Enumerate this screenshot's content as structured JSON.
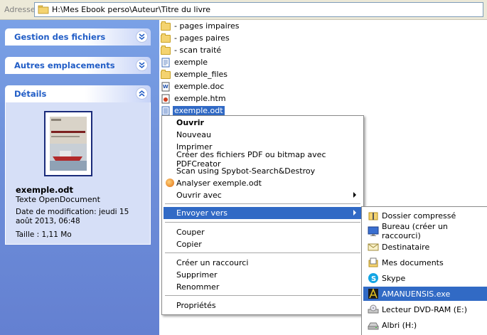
{
  "address_bar": {
    "label": "Adresse",
    "path": "H:\\Mes Ebook perso\\Auteur\\Titre du livre"
  },
  "left_pane": {
    "sections": [
      {
        "title": "Gestion des fichiers",
        "toggle_icon": "double-chevron-down-icon"
      },
      {
        "title": "Autres emplacements",
        "toggle_icon": "double-chevron-down-icon"
      },
      {
        "title": "Détails",
        "toggle_icon": "double-chevron-up-icon"
      }
    ],
    "details": {
      "file_name": "exemple.odt",
      "file_type": "Texte OpenDocument",
      "date": "Date de modification: jeudi 15 août 2013, 06:48",
      "size": "Taille : 1,11 Mo"
    }
  },
  "files": [
    {
      "name": "- pages impaires",
      "icon": "folder-icon"
    },
    {
      "name": "- pages paires",
      "icon": "folder-icon"
    },
    {
      "name": "- scan traité",
      "icon": "folder-icon"
    },
    {
      "name": "exemple",
      "icon": "document-icon"
    },
    {
      "name": "exemple_files",
      "icon": "folder-icon"
    },
    {
      "name": "exemple.doc",
      "icon": "word-document-icon"
    },
    {
      "name": "exemple.htm",
      "icon": "html-document-icon"
    },
    {
      "name": "exemple.odt",
      "icon": "odt-document-icon",
      "selected": true
    }
  ],
  "context_menu": {
    "items": [
      {
        "label": "Ouvrir",
        "bold": true
      },
      {
        "label": "Nouveau"
      },
      {
        "label": "Imprimer"
      },
      {
        "label": "Créer des fichiers PDF ou bitmap avec PDFCreator"
      },
      {
        "label": "Scan using Spybot-Search&Destroy"
      },
      {
        "label": "Analyser exemple.odt",
        "icon": "antivirus-icon"
      },
      {
        "label": "Ouvrir avec",
        "submenu": true
      },
      {
        "label": "Envoyer vers",
        "submenu": true,
        "highlighted": true
      },
      {
        "label": "Couper"
      },
      {
        "label": "Copier"
      },
      {
        "label": "Créer un raccourci"
      },
      {
        "label": "Supprimer"
      },
      {
        "label": "Renommer"
      },
      {
        "label": "Propriétés"
      }
    ]
  },
  "send_to_submenu": {
    "items": [
      {
        "label": "Dossier compressé",
        "icon": "zip-folder-icon"
      },
      {
        "label": "Bureau (créer un raccourci)",
        "icon": "desktop-icon"
      },
      {
        "label": "Destinataire",
        "icon": "mail-recipient-icon"
      },
      {
        "label": "Mes documents",
        "icon": "my-documents-icon"
      },
      {
        "label": "Skype",
        "icon": "skype-icon"
      },
      {
        "label": "AMANUENSIS.exe",
        "icon": "amanuensis-icon",
        "highlighted": true
      },
      {
        "label": "Lecteur DVD-RAM (E:)",
        "icon": "dvd-drive-icon"
      },
      {
        "label": "Albri (H:)",
        "icon": "drive-icon"
      }
    ]
  },
  "colors": {
    "selection": "#316ac5",
    "task_pane": "#6f91db",
    "section_title": "#215dc6"
  }
}
